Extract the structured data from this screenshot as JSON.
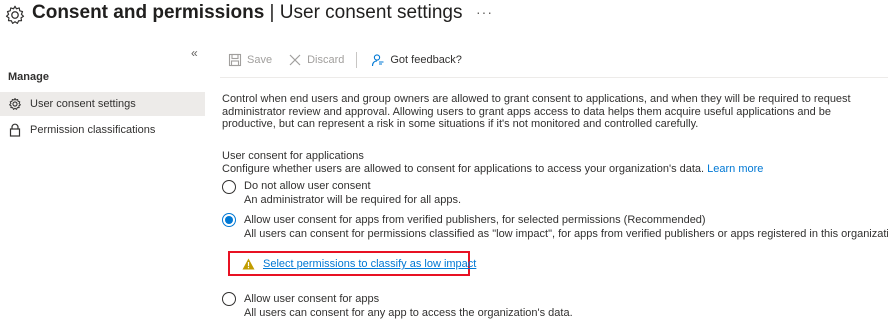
{
  "header": {
    "title_main": "Consent and permissions",
    "title_sep": " | ",
    "title_sub": "User consent settings",
    "more": "···"
  },
  "sidebar": {
    "collapse": "«",
    "section_label": "Manage",
    "items": [
      {
        "label": "User consent settings",
        "icon": "gear-icon",
        "selected": true
      },
      {
        "label": "Permission classifications",
        "icon": "lock-icon",
        "selected": false
      }
    ]
  },
  "toolbar": {
    "save_label": "Save",
    "discard_label": "Discard",
    "feedback_label": "Got feedback?"
  },
  "main": {
    "description": "Control when end users and group owners are allowed to grant consent to applications, and when they will be required to request administrator review and approval. Allowing users to grant apps access to data helps them acquire useful applications and be productive, but can represent a risk in some situations if it's not monitored and controlled carefully.",
    "section_title": "User consent for applications",
    "section_desc": "Configure whether users are allowed to consent for applications to access your organization's data.",
    "learn_more": "Learn more",
    "options": [
      {
        "label": "Do not allow user consent",
        "sub": "An administrator will be required for all apps.",
        "checked": false
      },
      {
        "label": "Allow user consent for apps from verified publishers, for selected permissions (Recommended)",
        "sub": "All users can consent for permissions classified as \"low impact\", for apps from verified publishers or apps registered in this organization.",
        "checked": true
      },
      {
        "label": "Allow user consent for apps",
        "sub": "All users can consent for any app to access the organization's data.",
        "checked": false
      }
    ],
    "warning_link": "Select permissions to classify as low impact"
  },
  "colors": {
    "accent": "#0078d4",
    "highlight_border": "#e81123",
    "warning": "#c19c00"
  }
}
